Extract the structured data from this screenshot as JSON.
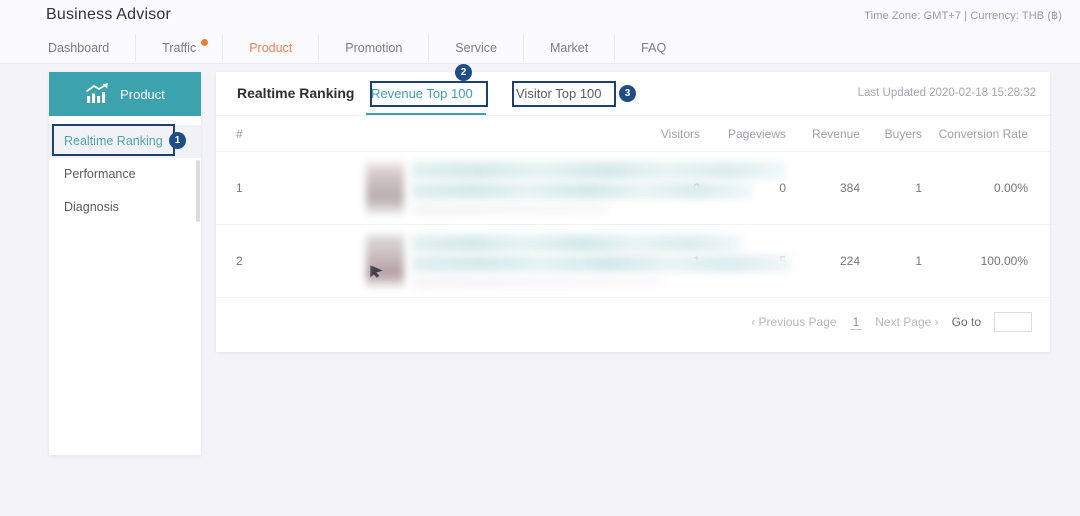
{
  "header": {
    "app_title": "Business Advisor",
    "meta": "Time Zone: GMT+7 | Currency: THB (฿)",
    "nav": [
      {
        "label": "Dashboard",
        "active": false,
        "dot": false
      },
      {
        "label": "Traffic",
        "active": false,
        "dot": true
      },
      {
        "label": "Product",
        "active": true,
        "dot": false
      },
      {
        "label": "Promotion",
        "active": false,
        "dot": false
      },
      {
        "label": "Service",
        "active": false,
        "dot": false
      },
      {
        "label": "Market",
        "active": false,
        "dot": false
      },
      {
        "label": "FAQ",
        "active": false,
        "dot": false
      }
    ]
  },
  "sidebar": {
    "header_label": "Product",
    "header_icon": "bar-chart-up-icon",
    "items": [
      {
        "label": "Realtime Ranking",
        "active": true
      },
      {
        "label": "Performance",
        "active": false
      },
      {
        "label": "Diagnosis",
        "active": false
      }
    ]
  },
  "panel": {
    "title": "Realtime Ranking",
    "tabs": [
      {
        "label": "Revenue Top 100",
        "active": true
      },
      {
        "label": "Visitor Top 100",
        "active": false
      }
    ],
    "last_updated": "Last Updated 2020-02-18 15:28:32"
  },
  "table": {
    "columns": [
      "#",
      "",
      "Visitors",
      "Pageviews",
      "Revenue",
      "Buyers",
      "Conversion Rate"
    ],
    "headers": {
      "rank": "#",
      "visitors": "Visitors",
      "pageviews": "Pageviews",
      "revenue": "Revenue",
      "buyers": "Buyers",
      "conversion": "Conversion Rate"
    },
    "rows": [
      {
        "rank": "1",
        "product": "",
        "visitors": "0",
        "pageviews": "0",
        "revenue": "384",
        "buyers": "1",
        "conversion": "0.00%"
      },
      {
        "rank": "2",
        "product": "",
        "visitors": "1",
        "pageviews": "5",
        "revenue": "224",
        "buyers": "1",
        "conversion": "100.00%"
      }
    ]
  },
  "pagination": {
    "previous": "‹ Previous Page",
    "current_page": "1",
    "next": "Next Page ›",
    "goto_label": "Go to",
    "goto_value": ""
  },
  "annotations": [
    {
      "id": "1",
      "target": "sidebar-item-realtime-ranking"
    },
    {
      "id": "2",
      "target": "tab-revenue-top-100"
    },
    {
      "id": "3",
      "target": "tab-visitor-top-100"
    }
  ],
  "colors": {
    "brand_teal": "#3ba2ae",
    "active_orange": "#f08050",
    "annotation_navy": "#1f3f72",
    "badge_navy": "#1f4e87",
    "page_bg": "#f3f3f8"
  }
}
